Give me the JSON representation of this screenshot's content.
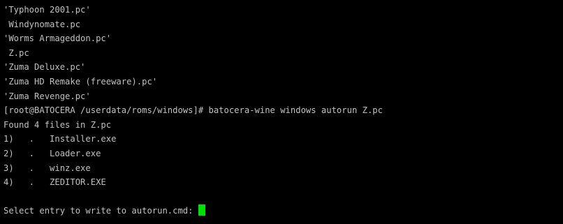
{
  "terminal": {
    "lines": [
      "'Typhoon 2001.pc'",
      " Windynomate.pc",
      "'Worms Armageddon.pc'",
      " Z.pc",
      "'Zuma Deluxe.pc'",
      "'Zuma HD Remake (freeware).pc'",
      "'Zuma Revenge.pc'",
      "[root@BATOCERA /userdata/roms/windows]# batocera-wine windows autorun Z.pc",
      "Found 4 files in Z.pc",
      "1)   .   Installer.exe",
      "2)   .   Loader.exe",
      "3)   .   winz.exe",
      "4)   .   ZEDITOR.EXE"
    ],
    "prompt": "Select entry to write to autorun.cmd: ",
    "colors": {
      "background": "#000000",
      "text": "#c0c0c0",
      "cursor": "#00e000"
    }
  }
}
